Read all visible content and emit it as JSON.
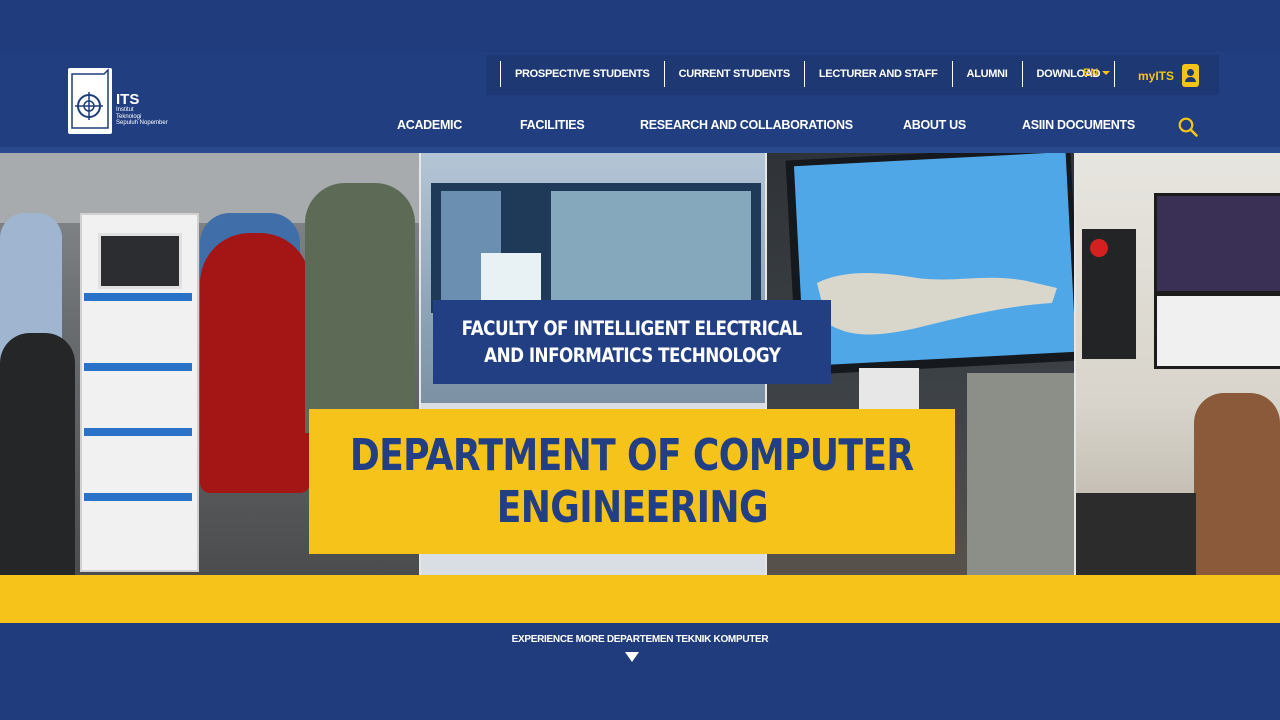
{
  "logo": {
    "title": "ITS",
    "subtitle_lines": [
      "Institut",
      "Teknologi",
      "Sepuluh Nopember"
    ]
  },
  "topbar": {
    "links": [
      {
        "label": "PROSPECTIVE STUDENTS"
      },
      {
        "label": "CURRENT STUDENTS"
      },
      {
        "label": "LECTURER AND STAFF"
      },
      {
        "label": "ALUMNI"
      },
      {
        "label": "DOWNLOAD"
      }
    ],
    "language": "EN",
    "account_label": "myITS"
  },
  "mainnav": {
    "items": [
      {
        "label": "ACADEMIC"
      },
      {
        "label": "FACILITIES"
      },
      {
        "label": "RESEARCH AND COLLABORATIONS"
      },
      {
        "label": "ABOUT US"
      },
      {
        "label": "ASIIN DOCUMENTS"
      }
    ],
    "search_icon": "search-icon"
  },
  "hero": {
    "faculty_lines": [
      "FACULTY OF INTELLIGENT ELECTRICAL",
      "AND INFORMATICS TECHNOLOGY"
    ],
    "department_lines": [
      "DEPARTMENT OF COMPUTER",
      "ENGINEERING"
    ]
  },
  "explore": {
    "label": "EXPERIENCE MORE DEPARTEMEN TEKNIK KOMPUTER",
    "arrow_icon": "triangle-down-icon"
  },
  "colors": {
    "brand_blue": "#203c7c",
    "brand_yellow": "#f6c31a",
    "white": "#ffffff"
  }
}
